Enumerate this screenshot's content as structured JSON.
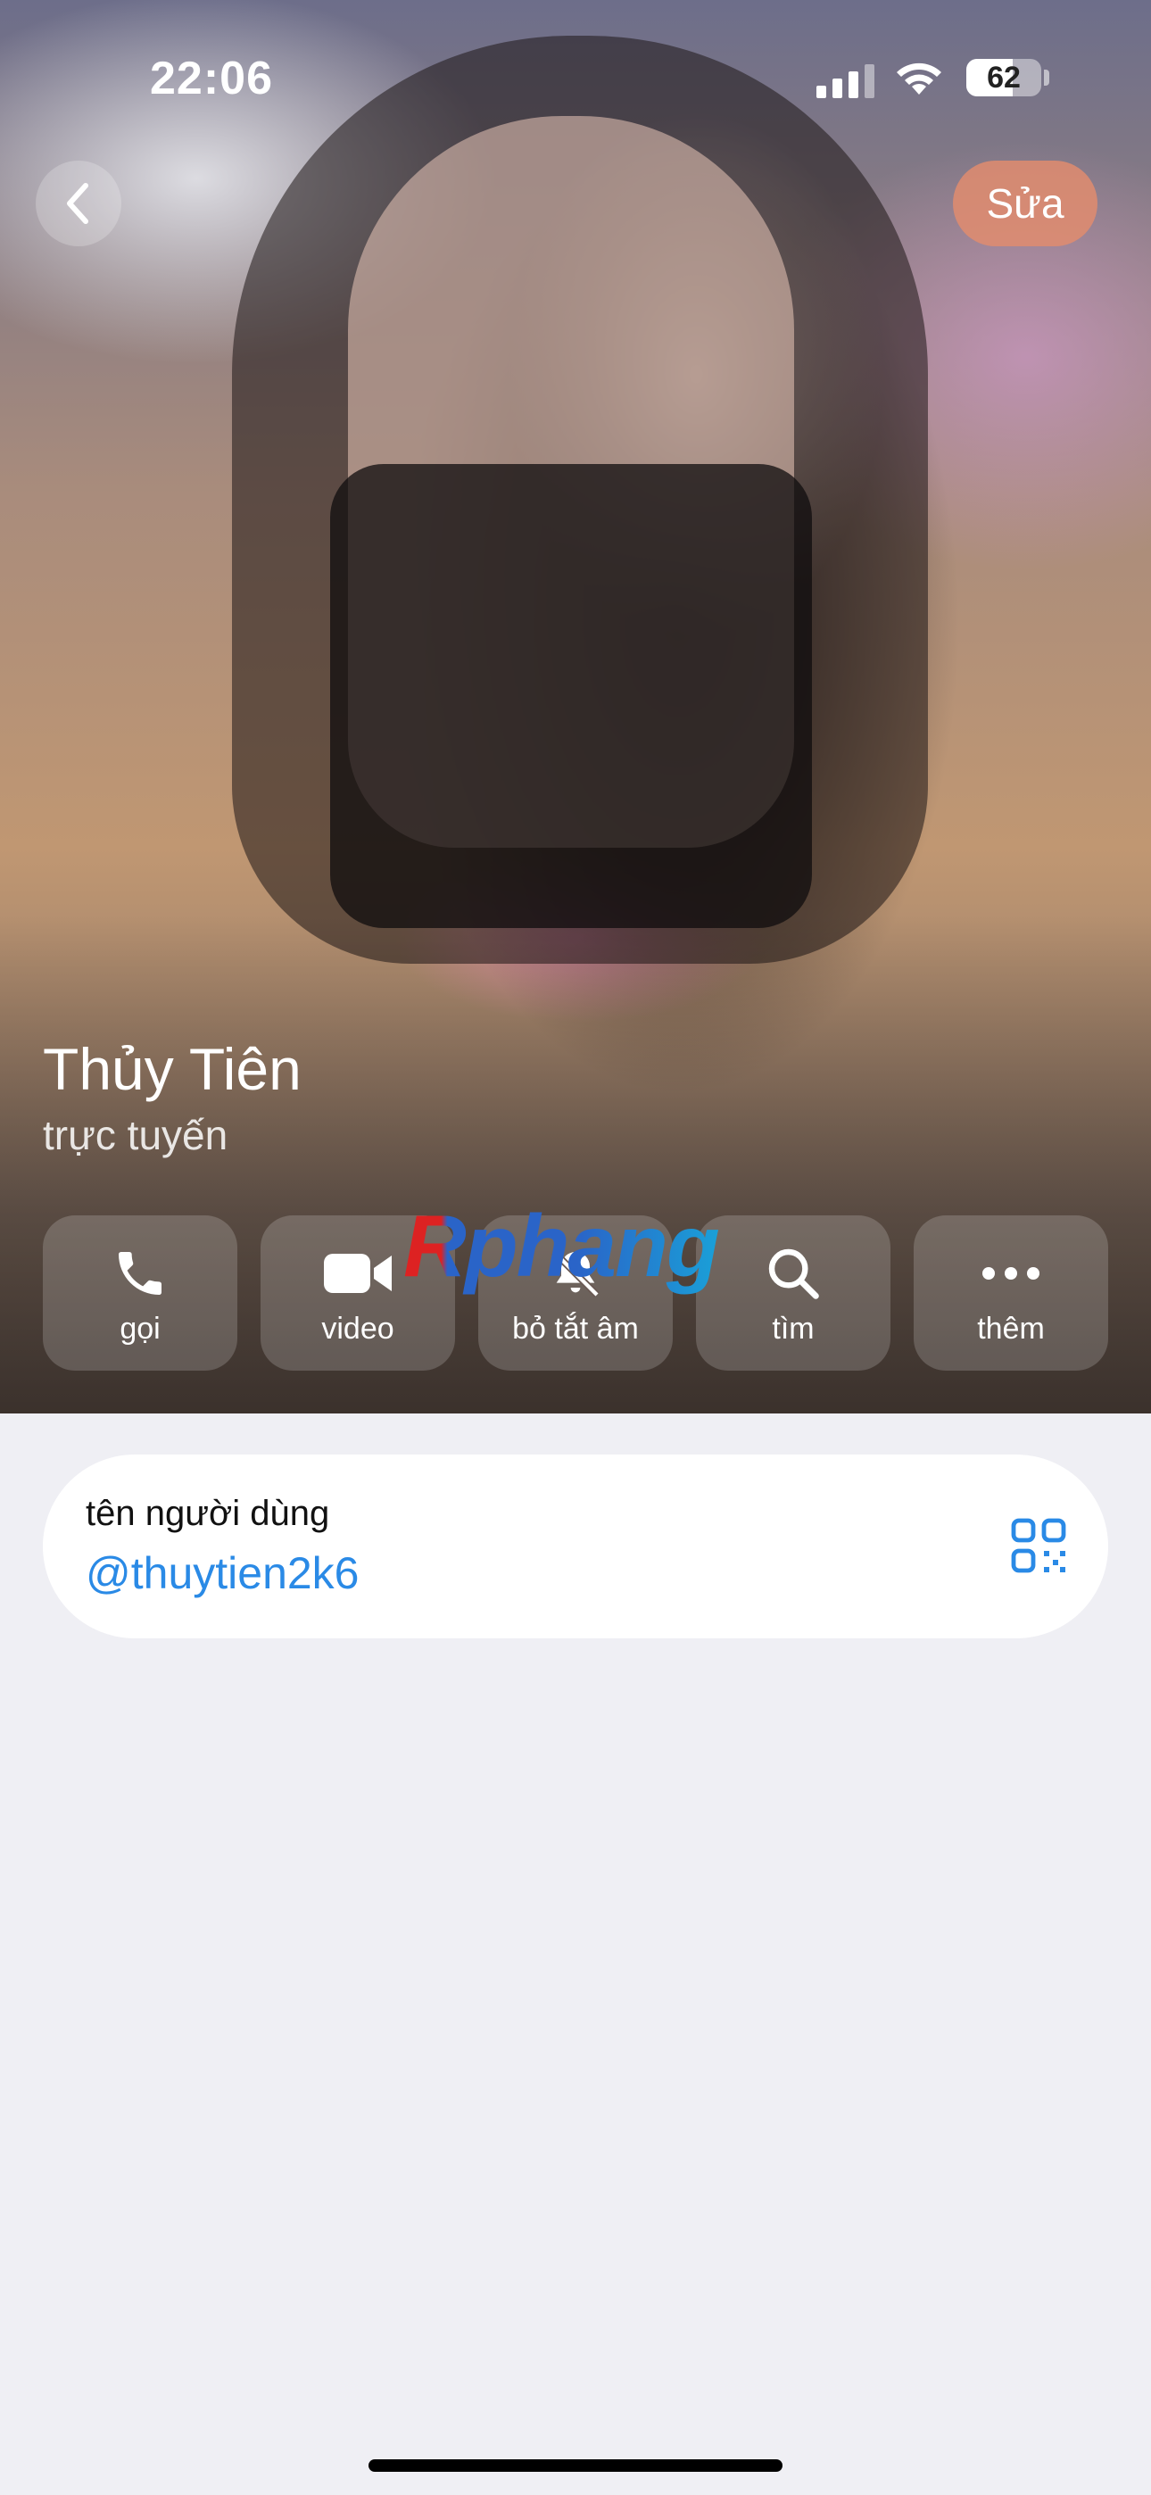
{
  "status_bar": {
    "time": "22:06",
    "battery": "62",
    "battery_level": 0.62
  },
  "nav": {
    "back_icon": "chevron-left-icon",
    "edit_label": "Sửa"
  },
  "profile": {
    "name": "Thủy Tiên",
    "presence": "trực tuyến"
  },
  "actions": [
    {
      "icon": "phone-icon",
      "label": "gọi"
    },
    {
      "icon": "video-camera-icon",
      "label": "video"
    },
    {
      "icon": "bell-slash-icon",
      "label": "bỏ tắt âm"
    },
    {
      "icon": "search-icon",
      "label": "tìm"
    },
    {
      "icon": "more-icon",
      "label": "thêm"
    }
  ],
  "watermark": "Rphang",
  "username_card": {
    "label": "tên người dùng",
    "value": "@thuytien2k6",
    "qr_icon": "qr-code-icon"
  },
  "colors": {
    "accent": "#2a8ae6",
    "edit_button": "#e18c6e",
    "page_background": "#efeff4"
  }
}
